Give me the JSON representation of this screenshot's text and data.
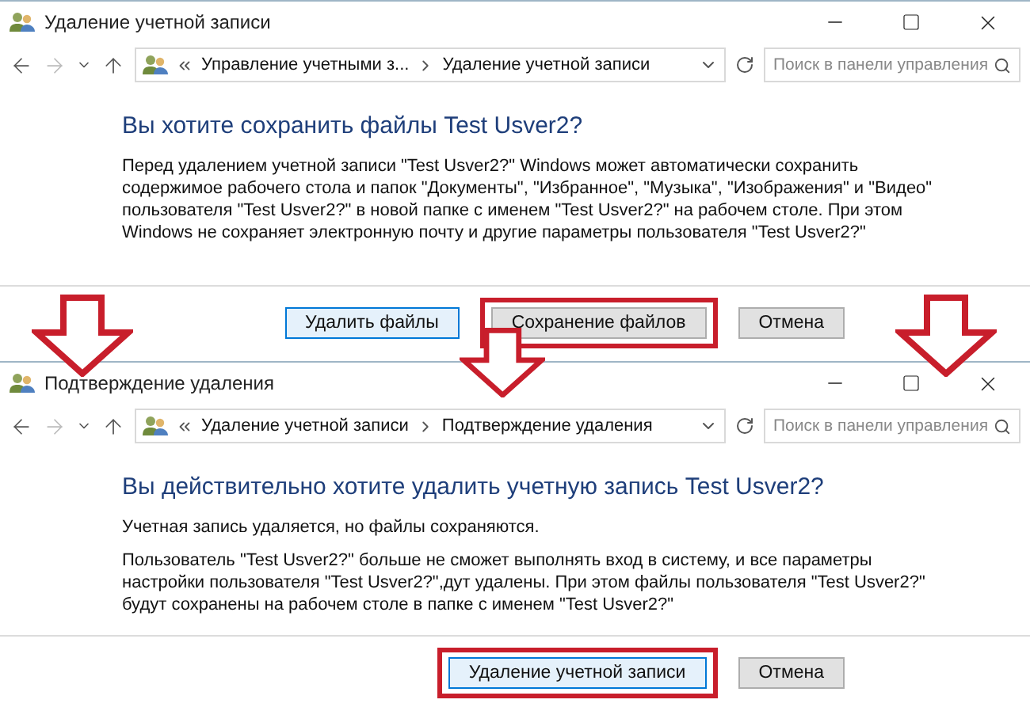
{
  "windows": [
    {
      "title": "Удаление учетной записи",
      "breadcrumbs": [
        "Управление учетными з...",
        "Удаление учетной записи"
      ],
      "search": {
        "placeholder": "Поиск в панели управления"
      },
      "heading": "Вы хотите сохранить файлы Test Usver2?",
      "paragraphs": [
        "Перед удалением учетной записи \"Test Usver2?\" Windows может автоматически сохранить содержимое рабочего стола и папок \"Документы\", \"Избранное\", \"Музыка\", \"Изображения\" и \"Видео\" пользователя \"Test Usver2?\" в новой папке с именем \"Test Usver2?\" на рабочем столе. При этом Windows не сохраняет электронную почту и другие параметры пользователя \"Test Usver2?\""
      ],
      "buttons": [
        {
          "label": "Удалить файлы",
          "default": true,
          "highlighted": false
        },
        {
          "label": "Сохранение файлов",
          "default": false,
          "highlighted": true
        },
        {
          "label": "Отмена",
          "default": false,
          "highlighted": false
        }
      ]
    },
    {
      "title": "Подтверждение удаления",
      "breadcrumbs": [
        "Удаление учетной записи",
        "Подтверждение удаления"
      ],
      "search": {
        "placeholder": "Поиск в панели управления"
      },
      "heading": "Вы действительно хотите удалить учетную запись Test Usver2?",
      "paragraphs": [
        "Учетная запись удаляется, но файлы сохраняются.",
        "Пользователь \"Test Usver2?\"    больше не сможет выполнять вход в систему, и все параметры настройки пользователя \"Test Usver2?\",дут удалены. При этом файлы пользователя \"Test Usver2?\" будут сохранены на рабочем столе в папке с именем \"Test Usver2?\""
      ],
      "buttons": [
        {
          "label": "Удаление учетной записи",
          "default": true,
          "highlighted": true
        },
        {
          "label": "Отмена",
          "default": false,
          "highlighted": false
        }
      ]
    }
  ]
}
